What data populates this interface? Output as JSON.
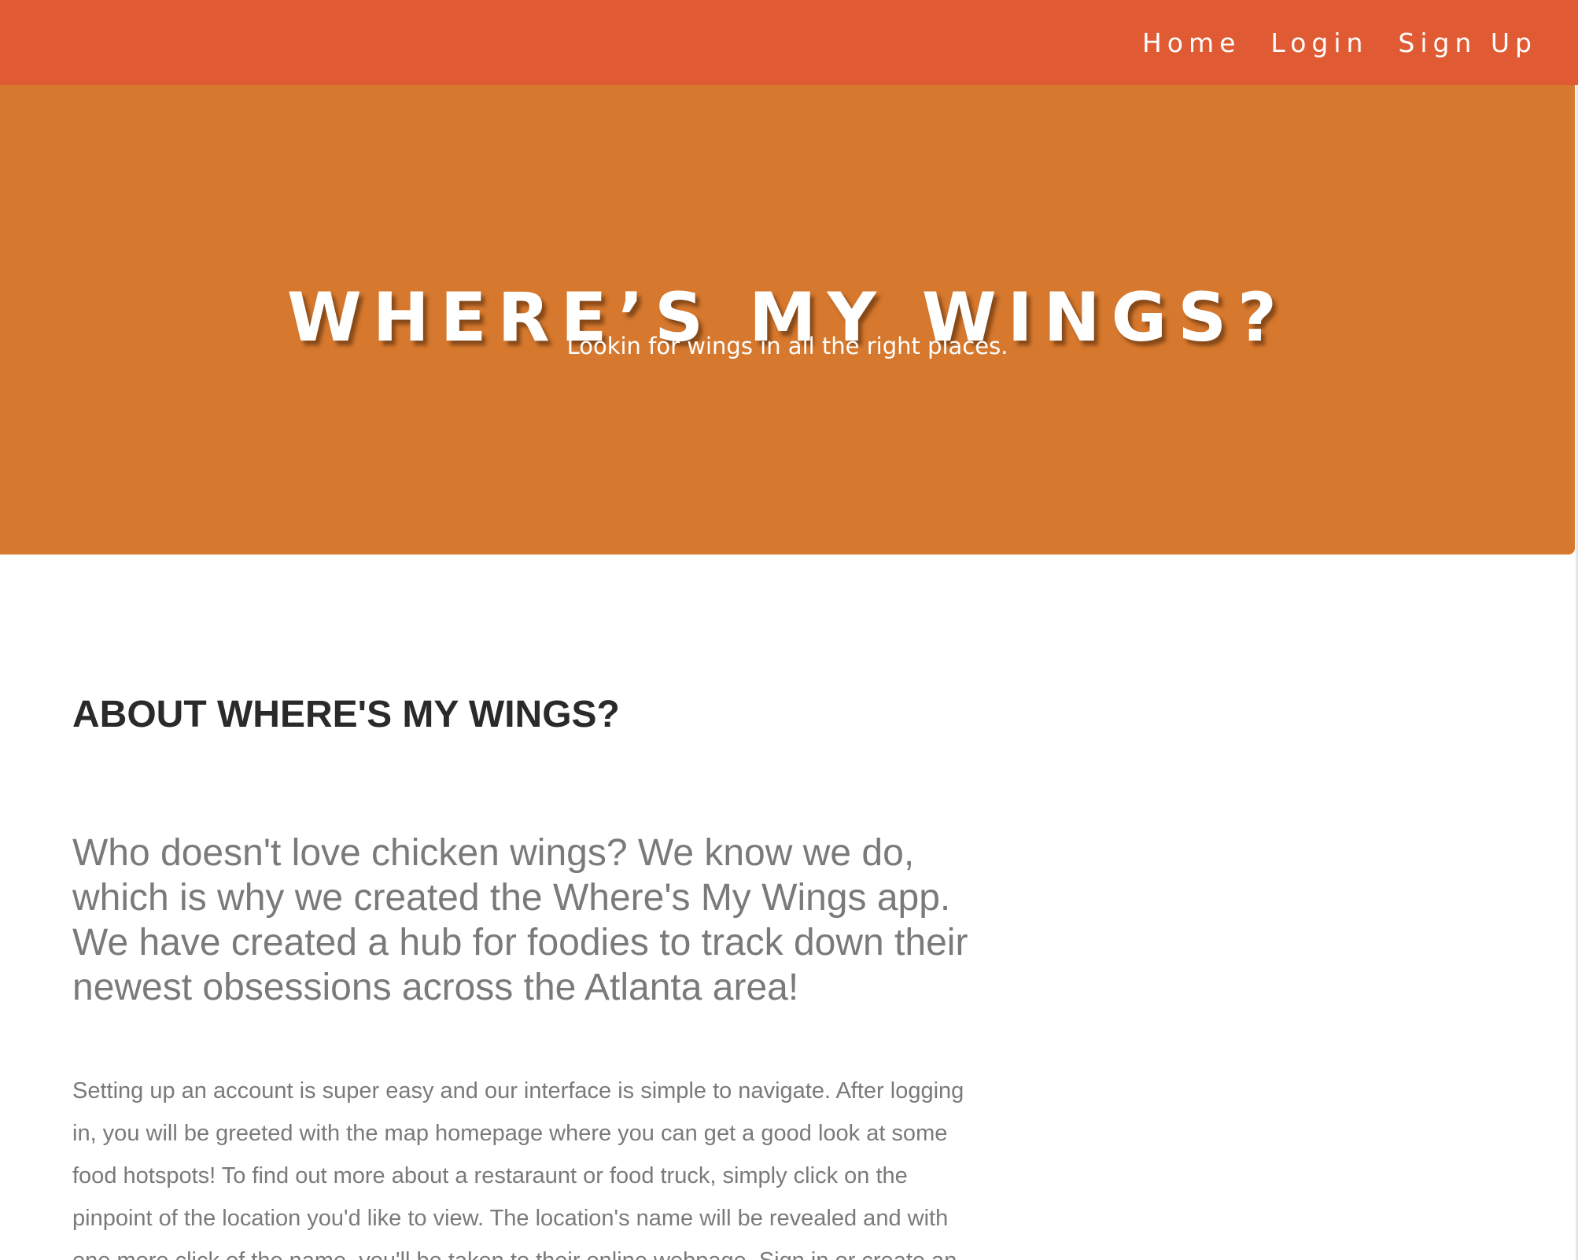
{
  "nav": {
    "links": [
      "Home",
      "Login",
      "Sign Up"
    ]
  },
  "hero": {
    "title": "WHERE’S MY WINGS?",
    "subtitle": "Lookin for wings in all the right places."
  },
  "about": {
    "heading": "ABOUT WHERE'S MY WINGS?",
    "lead_lines": [
      "Who doesn't love chicken wings? We know we do,",
      "which is why we created the Where's My Wings app.",
      "We have created a hub for foodies to track down their",
      "newest obsessions across the Atlanta area!"
    ],
    "body_lines": [
      "Setting up an account is super easy and our interface is simple to navigate. After logging",
      "in, you will be greeted with the map homepage where you can get a good look at some",
      "food hotspots! To find out more about a restaraunt or food truck, simply click on the",
      "pinpoint of the location you'd like to view. The location's name will be revealed and with",
      "one more click of the name, you'll be taken to their online webpage. Sign in or create an"
    ]
  },
  "colors": {
    "navbar": "#e05a33",
    "hero": "#d6782d",
    "heading": "#2a2a2a",
    "text": "#7a7a7a"
  }
}
